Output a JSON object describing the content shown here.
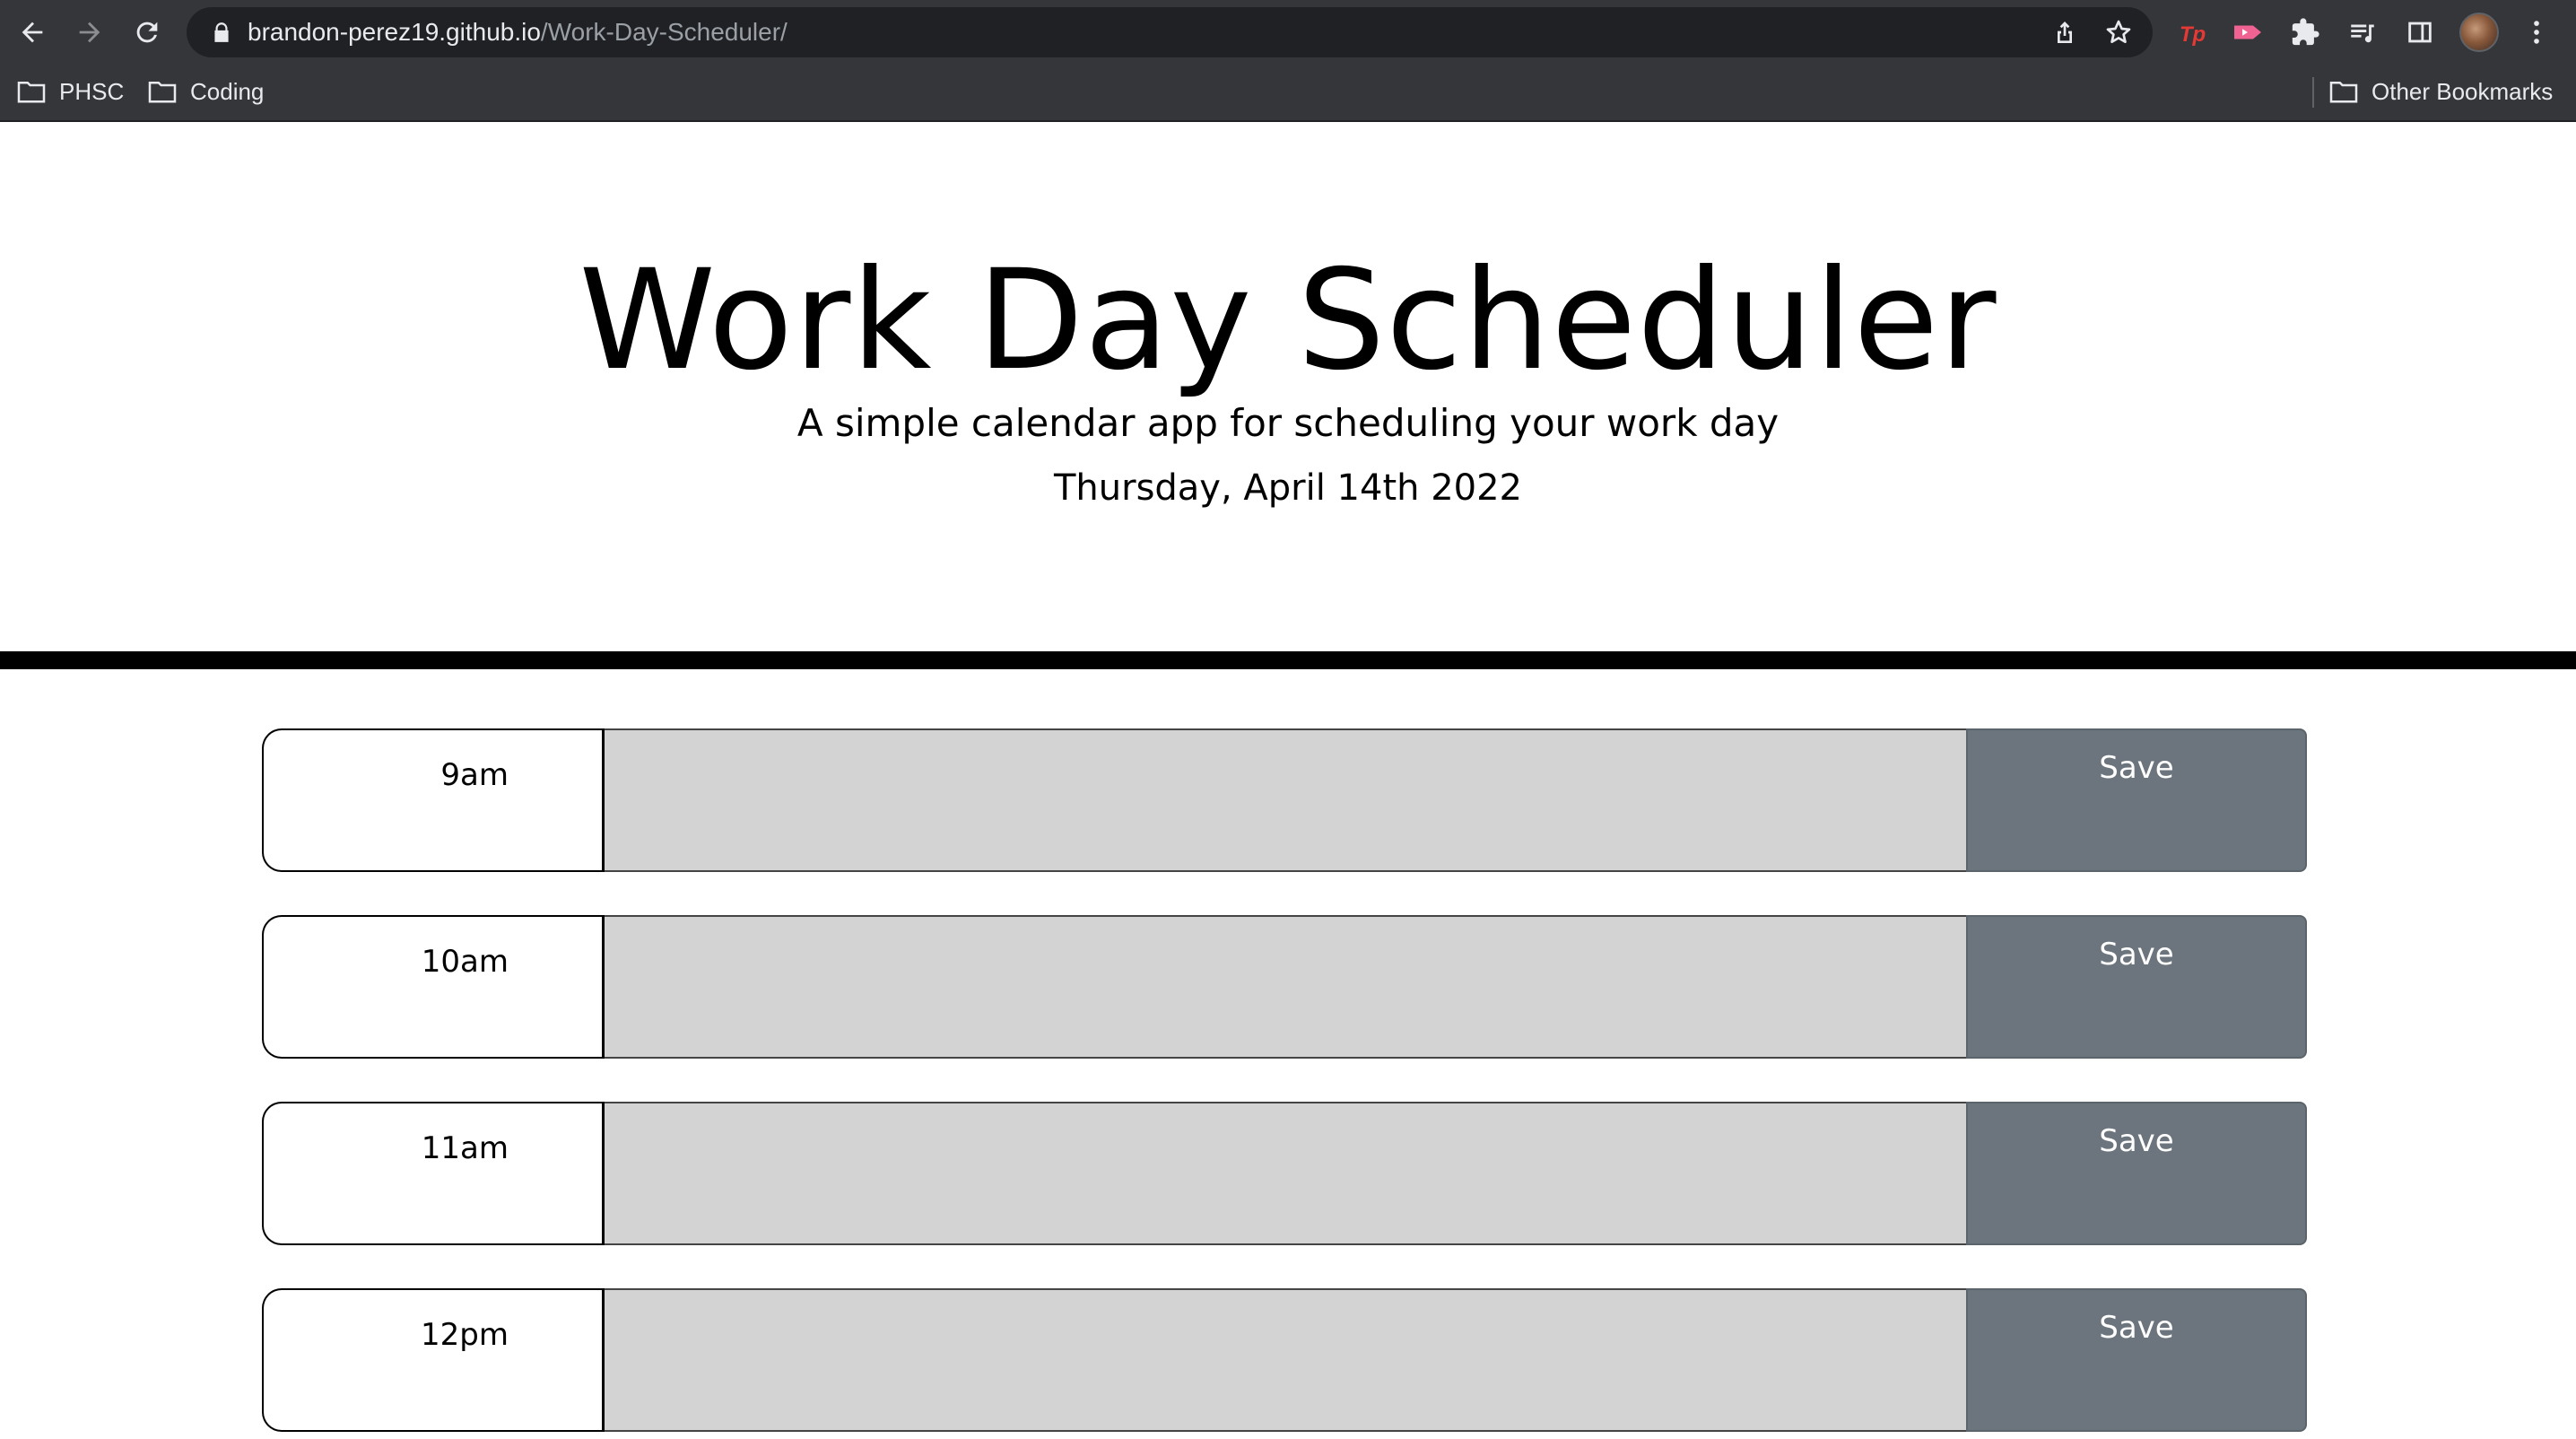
{
  "browser": {
    "url_host": "brandon-perez19.github.io",
    "url_path": "/Work-Day-Scheduler/",
    "bookmarks": [
      "PHSC",
      "Coding"
    ],
    "other_bookmarks": "Other Bookmarks",
    "extensions": [
      "tp-extension-icon",
      "video-extension-icon",
      "puzzle-icon",
      "reading-list-icon",
      "side-panel-icon"
    ]
  },
  "header": {
    "title": "Work Day Scheduler",
    "subtitle": "A simple calendar app for scheduling your work day",
    "current_day": "Thursday, April 14th 2022"
  },
  "time_blocks": [
    {
      "hour": "9am",
      "text": "",
      "save_label": "Save"
    },
    {
      "hour": "10am",
      "text": "",
      "save_label": "Save"
    },
    {
      "hour": "11am",
      "text": "",
      "save_label": "Save"
    },
    {
      "hour": "12pm",
      "text": "",
      "save_label": "Save"
    }
  ],
  "colors": {
    "chrome_bg": "#35363a",
    "omnibox_bg": "#202124",
    "past_block": "#d3d3d3",
    "save_button": "#6c757d"
  }
}
